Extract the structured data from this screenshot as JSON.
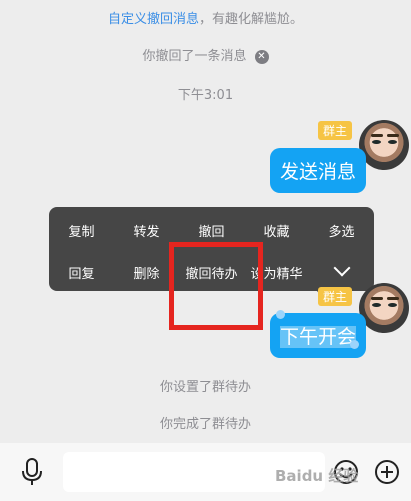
{
  "system": {
    "hint_link": "自定义撤回消息",
    "hint_rest": "，有趣化解尴尬。",
    "recall": "你撤回了一条消息",
    "time": "下午3:01",
    "set_todo": "你设置了群待办",
    "done_todo": "你完成了群待办"
  },
  "messages": [
    {
      "badge": "群主",
      "text": "发送消息"
    },
    {
      "badge": "群主",
      "text": "下午开会"
    }
  ],
  "menu": {
    "row1": [
      "复制",
      "转发",
      "撤回",
      "收藏",
      "多选"
    ],
    "row2": [
      "回复",
      "删除",
      "撤回待办",
      "设为精华"
    ]
  },
  "watermark": "Baidu 经验",
  "colors": {
    "bubble": "#14a3f3",
    "menu": "#464646",
    "highlight_box": "#e5251f",
    "badge": "#f6c445",
    "link": "#3a8ee6"
  },
  "icons": [
    "close-circle-icon",
    "chevron-down-icon",
    "microphone-icon",
    "emoji-icon",
    "plus-circle-icon"
  ]
}
